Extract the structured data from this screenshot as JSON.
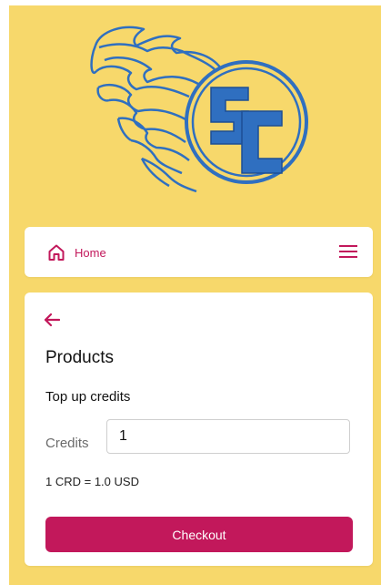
{
  "nav": {
    "home_label": "Home",
    "home_icon": "home-icon",
    "menu_icon": "hamburger-menu-icon"
  },
  "colors": {
    "background": "#f7d86b",
    "accent": "#c2185b",
    "logo_blue": "#2f6fc0"
  },
  "logo": {
    "text": "SC"
  },
  "products": {
    "back_icon": "arrow-left-icon",
    "title": "Products",
    "subtitle": "Top up credits",
    "credits_label": "Credits",
    "credits_value": "1",
    "rate_text": "1 CRD = 1.0 USD",
    "checkout_label": "Checkout"
  }
}
